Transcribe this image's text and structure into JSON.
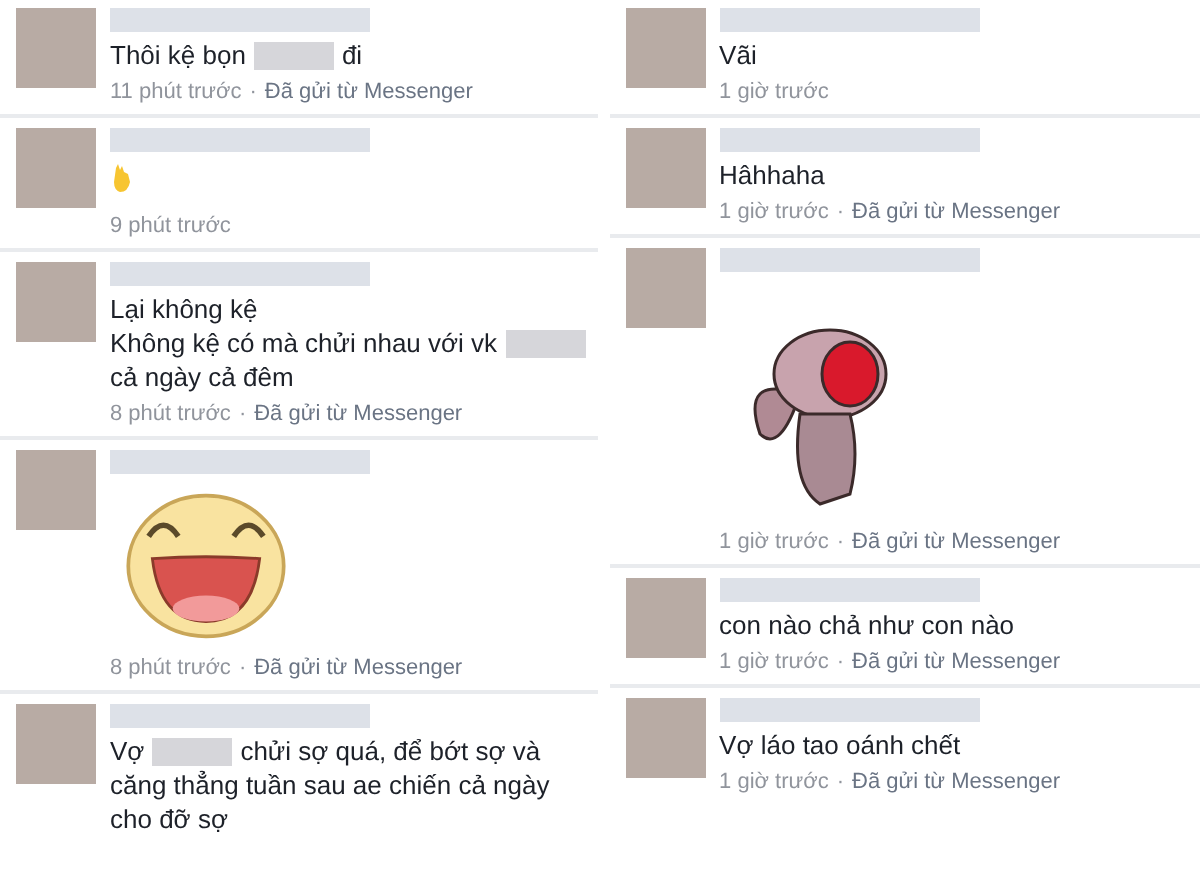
{
  "columns": [
    {
      "comments": [
        {
          "lines": [
            [
              {
                "kind": "text",
                "text": "Thôi kệ bọn"
              },
              {
                "kind": "redacted"
              },
              {
                "kind": "text",
                "text": "đi"
              }
            ]
          ],
          "time": "11 phút trước",
          "separator": "·",
          "source": "Đã gửi từ Messenger"
        },
        {
          "attachment": {
            "kind": "hand"
          },
          "time": "9 phút trước"
        },
        {
          "lines": [
            [
              {
                "kind": "text",
                "text": "Lại không kệ"
              }
            ],
            [
              {
                "kind": "text",
                "text": "Không kệ có mà chửi nhau với vk"
              },
              {
                "kind": "redacted"
              }
            ],
            [
              {
                "kind": "text",
                "text": "cả ngày cả đêm"
              }
            ]
          ],
          "time": "8 phút trước",
          "separator": "·",
          "source": "Đã gửi từ Messenger"
        },
        {
          "attachment": {
            "kind": "smiley"
          },
          "time": "8 phút trước",
          "separator": "·",
          "source": "Đã gửi từ Messenger"
        },
        {
          "lines": [
            [
              {
                "kind": "text",
                "text": "Vợ"
              },
              {
                "kind": "redacted"
              },
              {
                "kind": "text",
                "text": "chửi sợ quá, để bớt sợ và"
              }
            ],
            [
              {
                "kind": "text",
                "text": "căng thẳng tuần sau ae chiến cả ngày"
              }
            ],
            [
              {
                "kind": "text",
                "text": "cho đỡ sợ"
              }
            ]
          ]
        }
      ]
    },
    {
      "comments": [
        {
          "lines": [
            [
              {
                "kind": "text",
                "text": "Vãi"
              }
            ]
          ],
          "time": "1 giờ trước"
        },
        {
          "lines": [
            [
              {
                "kind": "text",
                "text": "Hâhhaha"
              }
            ]
          ],
          "time": "1 giờ trước",
          "separator": "·",
          "source": "Đã gửi từ Messenger"
        },
        {
          "attachment": {
            "kind": "rabbit"
          },
          "time": "1 giờ trước",
          "separator": "·",
          "source": "Đã gửi từ Messenger"
        },
        {
          "lines": [
            [
              {
                "kind": "text",
                "text": "con nào chả như con nào"
              }
            ]
          ],
          "time": "1 giờ trước",
          "separator": "·",
          "source": "Đã gửi từ Messenger"
        },
        {
          "lines": [
            [
              {
                "kind": "text",
                "text": "Vợ láo tao oánh chết"
              }
            ]
          ],
          "time": "1 giờ trước",
          "separator": "·",
          "source": "Đã gửi từ Messenger"
        }
      ]
    }
  ]
}
